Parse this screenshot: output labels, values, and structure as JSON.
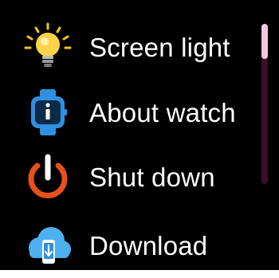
{
  "menu": {
    "items": [
      {
        "label": "Screen light",
        "icon": "lightbulb-icon"
      },
      {
        "label": "About watch",
        "icon": "watch-info-icon"
      },
      {
        "label": "Shut down",
        "icon": "power-icon"
      },
      {
        "label": "Download",
        "icon": "cloud-download-icon"
      }
    ]
  },
  "scrollbar": {
    "position_fraction": 0.0,
    "visible_fraction": 0.22
  },
  "colors": {
    "background": "#000000",
    "text": "#ffffff",
    "bulb_yellow": "#ffc21f",
    "watch_blue": "#2f8fe0",
    "power_orange": "#e8501a",
    "cloud_blue": "#4db0f0",
    "scrollbar_track": "#3a0f2a",
    "scrollbar_thumb": "#f2c9dc"
  }
}
